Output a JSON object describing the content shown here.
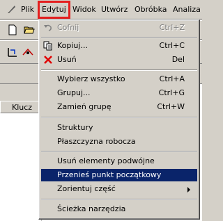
{
  "menubar": {
    "items": [
      {
        "label": "Plik"
      },
      {
        "label": "Edytuj"
      },
      {
        "label": "Widok"
      },
      {
        "label": "Utwórz"
      },
      {
        "label": "Obróbka"
      },
      {
        "label": "Analiza"
      }
    ],
    "active_index": 1,
    "active_outline_color": "#e41e1e"
  },
  "panel": {
    "column_header": "Klucz"
  },
  "dropdown": {
    "highlight_color": "#0a246a",
    "items": [
      {
        "label": "Cofnij",
        "shortcut": "Ctrl+Z",
        "icon": "undo-icon",
        "disabled": true
      },
      {
        "label": "Kopiuj...",
        "shortcut": "Ctrl+C",
        "icon": "copy-icon"
      },
      {
        "label": "Usuń",
        "shortcut": "Del",
        "icon": "delete-icon"
      },
      {
        "label": "Wybierz wszystko",
        "shortcut": "Ctrl+A"
      },
      {
        "label": "Grupuj...",
        "shortcut": "Ctrl+G"
      },
      {
        "label": "Zamień grupę",
        "shortcut": "Ctrl+W"
      },
      {
        "label": "Struktury",
        "shortcut": ""
      },
      {
        "label": "Płaszczyzna robocza",
        "shortcut": ""
      },
      {
        "label": "Usuń elementy podwójne",
        "shortcut": ""
      },
      {
        "label": "Przenieś punkt początkowy",
        "shortcut": "",
        "highlighted": true
      },
      {
        "label": "Zorientuj część",
        "shortcut": "",
        "submenu": true
      },
      {
        "label": "Ścieżka narzędzia",
        "shortcut": ""
      }
    ]
  }
}
